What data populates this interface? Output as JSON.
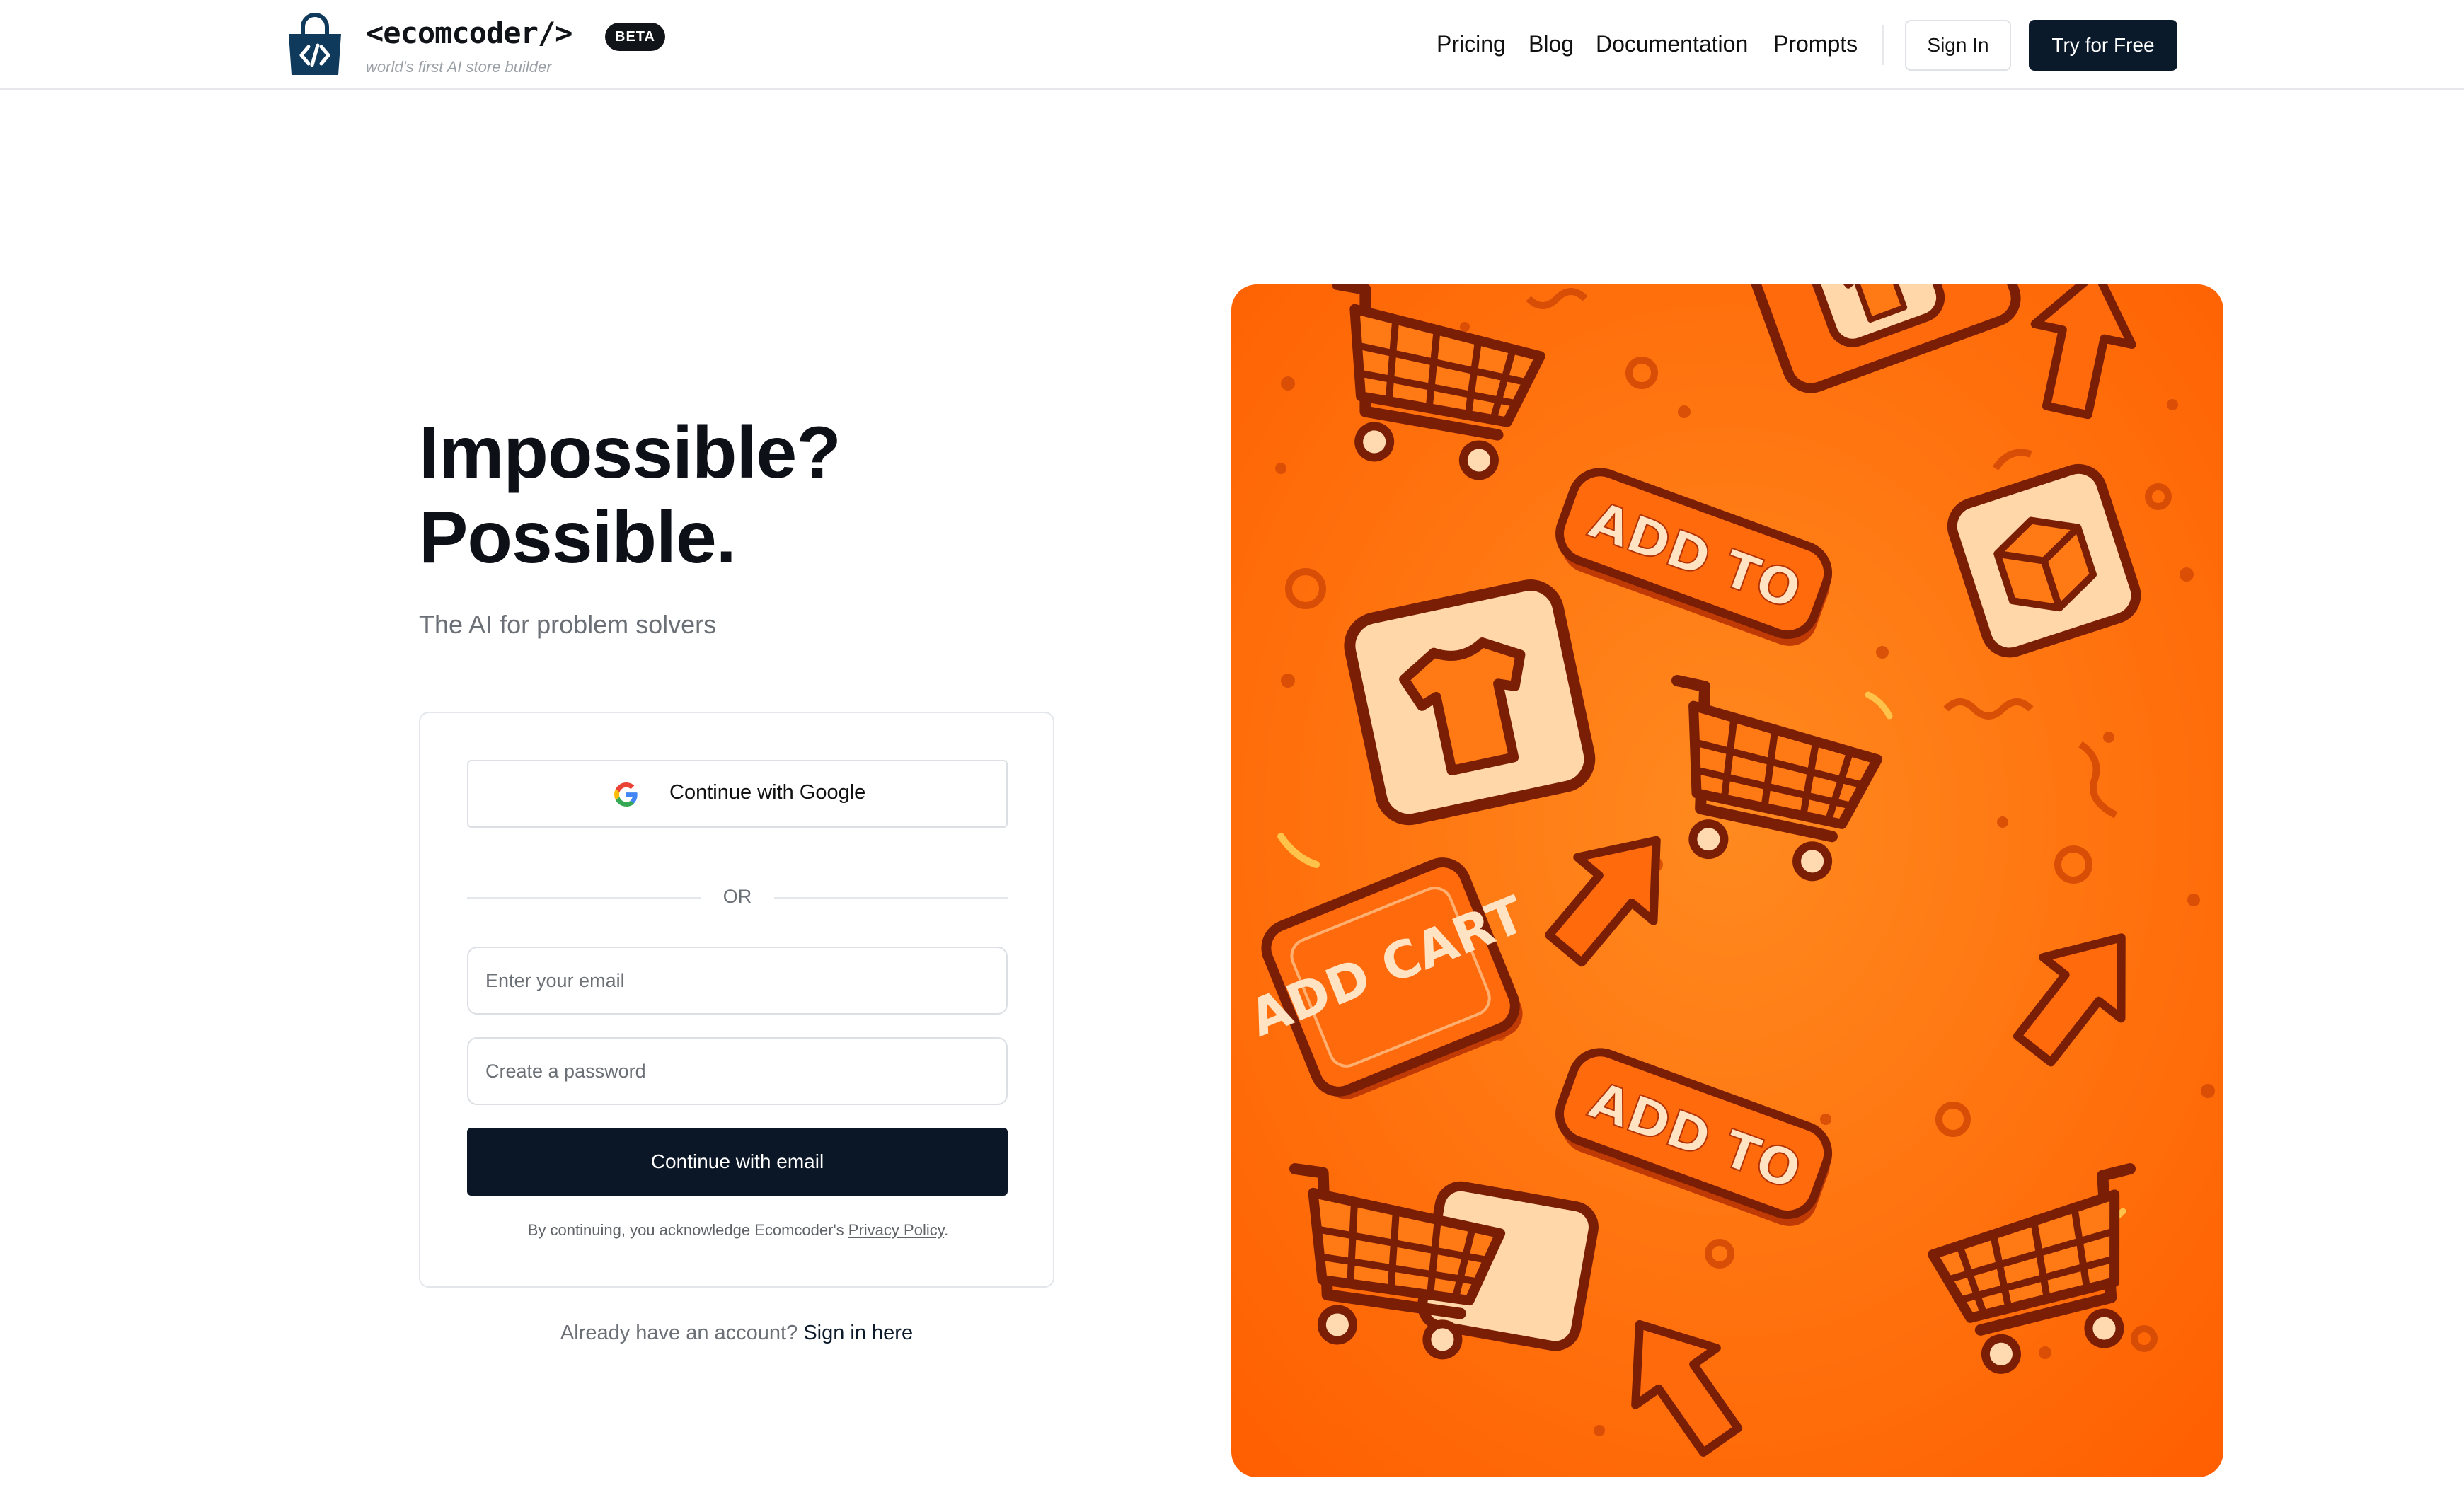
{
  "header": {
    "logo_text": "<ecomcoder/>",
    "beta_badge": "BETA",
    "tagline": "world's first AI store builder",
    "nav": [
      "Pricing",
      "Blog",
      "Documentation",
      "Prompts"
    ],
    "sign_in": "Sign In",
    "try_free": "Try for Free"
  },
  "hero": {
    "headline_line1": "Impossible?",
    "headline_line2": "Possible.",
    "subhead": "The AI for problem solvers"
  },
  "form": {
    "google_button": "Continue with Google",
    "or_divider": "OR",
    "email_placeholder": "Enter your email",
    "password_placeholder": "Create a password",
    "continue_button": "Continue with email",
    "legal_prefix": "By continuing, you acknowledge Ecomcoder's",
    "legal_link": "Privacy Policy",
    "legal_suffix": "."
  },
  "footer_prompt": {
    "text": "Already have an account?",
    "link": "Sign in here"
  },
  "illustration": {
    "badge_texts": [
      "ADD TO",
      "ADD TO",
      "ADD CART",
      "ADD TO"
    ],
    "icons": [
      "shopping-cart-icon",
      "t-shirt-icon",
      "box-icon",
      "arrow-cursor-icon"
    ]
  },
  "colors": {
    "primary_dark": "#0b1a2b",
    "illustration_orange": "#ff6a00",
    "illustration_outline": "#7a1e05"
  }
}
